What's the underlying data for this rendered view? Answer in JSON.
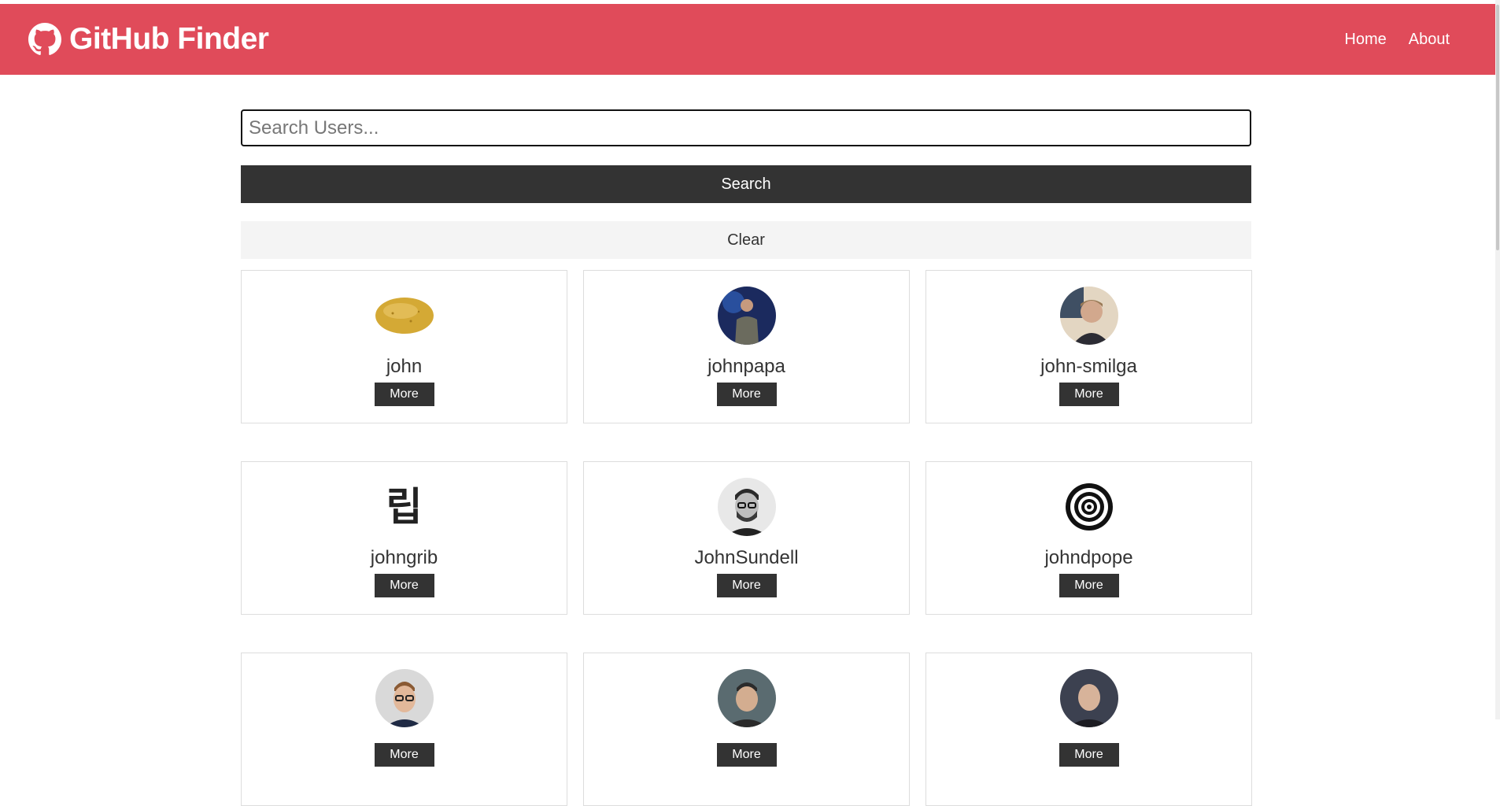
{
  "navbar": {
    "brand": "GitHub Finder",
    "brand_icon": "github-icon",
    "color": "#e04b5a",
    "links": [
      "Home",
      "About"
    ]
  },
  "search": {
    "placeholder": "Search Users...",
    "value": "",
    "search_label": "Search",
    "clear_label": "Clear"
  },
  "users": [
    {
      "login": "john",
      "avatar": "potato",
      "more_label": "More"
    },
    {
      "login": "johnpapa",
      "avatar": "person-on-stage",
      "more_label": "More"
    },
    {
      "login": "john-smilga",
      "avatar": "person-smiling",
      "more_label": "More"
    },
    {
      "login": "johngrib",
      "avatar": "hangul-glyph",
      "more_label": "More"
    },
    {
      "login": "JohnSundell",
      "avatar": "person-glasses-bw",
      "more_label": "More"
    },
    {
      "login": "johndpope",
      "avatar": "spiral",
      "more_label": "More"
    },
    {
      "login": "",
      "avatar": "person-glasses-suit",
      "more_label": "More"
    },
    {
      "login": "",
      "avatar": "person-smiling-dark",
      "more_label": "More"
    },
    {
      "login": "",
      "avatar": "person-bald",
      "more_label": "More"
    }
  ],
  "avatar_glyph_text": "립"
}
